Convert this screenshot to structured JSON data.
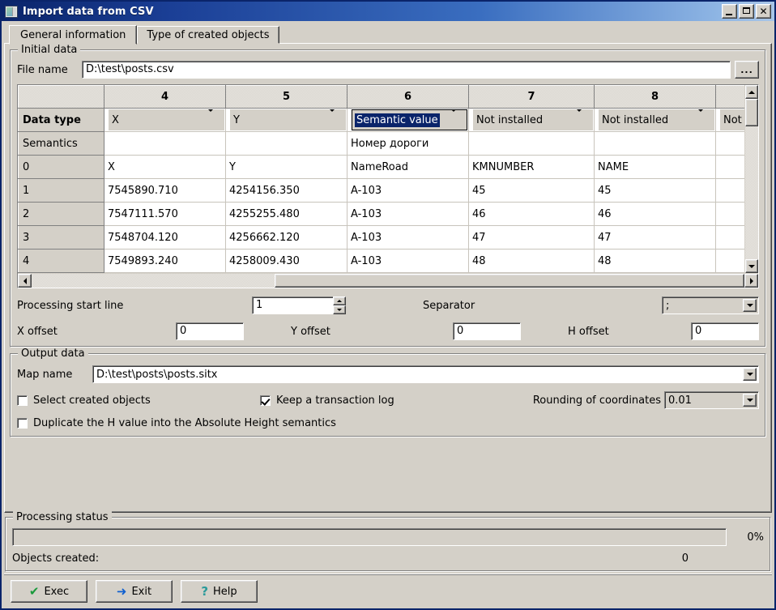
{
  "window": {
    "title": "Import data from CSV",
    "icon": "app-window-icon",
    "buttons": {
      "minimize": "_",
      "maximize": "□",
      "close": "✕"
    }
  },
  "tabs": [
    {
      "label": "General information",
      "active": true
    },
    {
      "label": "Type of created objects",
      "active": false
    }
  ],
  "initial_data": {
    "legend": "Initial data",
    "file_name_label": "File name",
    "file_name_value": "D:\\test\\posts.csv",
    "browse_label": "...",
    "grid": {
      "column_headers": [
        "",
        "4",
        "5",
        "6",
        "7",
        "8",
        ""
      ],
      "row_header_labels": [
        "Data type",
        "Semantics",
        "0",
        "1",
        "2",
        "3",
        "4"
      ],
      "data_type_row": [
        {
          "value": "X",
          "selected": false
        },
        {
          "value": "Y",
          "selected": false
        },
        {
          "value": "Semantic value",
          "selected": true
        },
        {
          "value": "Not installed",
          "selected": false
        },
        {
          "value": "Not installed",
          "selected": false
        },
        {
          "value": "Not in",
          "selected": false
        }
      ],
      "semantics_row": [
        "",
        "",
        "Номер дороги",
        "",
        "",
        ""
      ],
      "rows": [
        {
          "header": "0",
          "cells": [
            "X",
            "Y",
            "NameRoad",
            "KMNUMBER",
            "NAME",
            ""
          ]
        },
        {
          "header": "1",
          "cells": [
            "7545890.710",
            "4254156.350",
            "A-103",
            "45",
            "45",
            ""
          ]
        },
        {
          "header": "2",
          "cells": [
            "7547111.570",
            "4255255.480",
            "A-103",
            "46",
            "46",
            ""
          ]
        },
        {
          "header": "3",
          "cells": [
            "7548704.120",
            "4256662.120",
            "A-103",
            "47",
            "47",
            ""
          ]
        },
        {
          "header": "4",
          "cells": [
            "7549893.240",
            "4258009.430",
            "A-103",
            "48",
            "48",
            ""
          ]
        }
      ]
    },
    "processing_start_line_label": "Processing start line",
    "processing_start_line_value": "1",
    "separator_label": "Separator",
    "separator_value": ";",
    "x_offset_label": "X offset",
    "x_offset_value": "0",
    "y_offset_label": "Y offset",
    "y_offset_value": "0",
    "h_offset_label": "H offset",
    "h_offset_value": "0"
  },
  "output_data": {
    "legend": "Output data",
    "map_name_label": "Map name",
    "map_name_value": "D:\\test\\posts\\posts.sitx",
    "select_created_objects_label": "Select created objects",
    "select_created_objects_checked": false,
    "keep_transaction_log_label": "Keep a transaction log",
    "keep_transaction_log_checked": true,
    "rounding_label": "Rounding of coordinates",
    "rounding_value": "0.01",
    "duplicate_h_label": "Duplicate the H value into the Absolute Height semantics",
    "duplicate_h_checked": false
  },
  "processing_status": {
    "legend": "Processing status",
    "progress_percent_label": "0%",
    "progress_percent": 0,
    "objects_created_label": "Objects created:",
    "objects_created_value": "0"
  },
  "footer": {
    "exec_label": "Exec",
    "exit_label": "Exit",
    "help_label": "Help",
    "exec_icon": "check-icon",
    "exit_icon": "arrow-right-icon",
    "help_icon": "question-mark-icon"
  },
  "colors": {
    "title_start": "#0a246a",
    "title_end": "#a9c6e8",
    "face": "#d4d0c8",
    "selection": "#0a246a",
    "exec_icon": "#1a9a3c",
    "exit_icon": "#1060d0",
    "help_icon": "#2a9a9a"
  }
}
